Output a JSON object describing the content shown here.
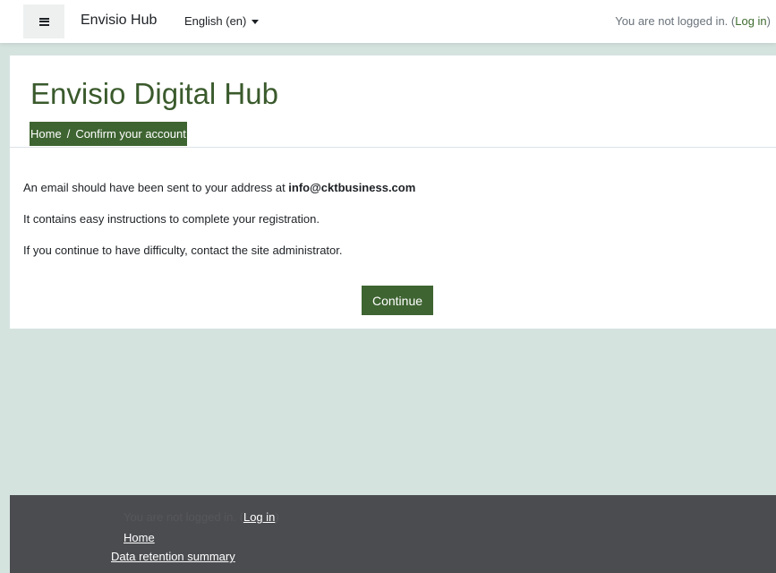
{
  "navbar": {
    "menu_icon": "hamburger-menu-icon",
    "brand": "Envisio Hub",
    "language": "English (en)",
    "language_icon": "caret-down-icon",
    "login_text": "You are not logged in. (",
    "login_link": "Log in",
    "login_suffix": ")"
  },
  "page": {
    "title": "Envisio Digital Hub",
    "breadcrumb": {
      "home": "Home",
      "separator": "/",
      "current": "Confirm your account"
    },
    "messages": {
      "line1_prefix": "An email should have been sent to your address at ",
      "email": "info@cktbusiness.com",
      "line2": "It contains easy instructions to complete your registration.",
      "line3": "If you continue to have difficulty, contact the site administrator."
    },
    "continue_label": "Continue"
  },
  "footer": {
    "login_text": "You are not logged in. (",
    "login_link": "Log in",
    "login_suffix": ")",
    "home_link": "Home",
    "data_retention_link": "Data retention summary"
  },
  "colors": {
    "brand_green": "#3e6431",
    "title_green": "#3a5a2c",
    "page_background": "#d5e3df",
    "footer_background": "#4b4c50"
  }
}
